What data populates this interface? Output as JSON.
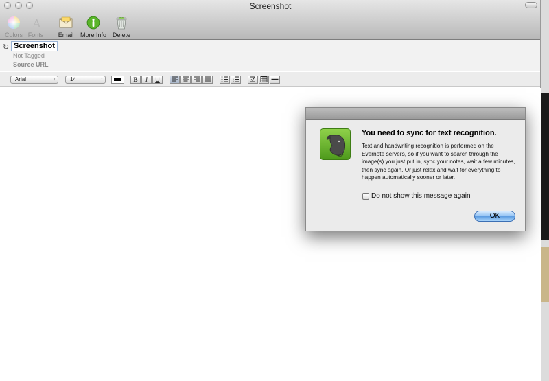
{
  "window": {
    "title": "Screenshot"
  },
  "toolbar": {
    "items": [
      {
        "label": "Colors",
        "icon": "color-wheel-icon",
        "enabled": false
      },
      {
        "label": "Fonts",
        "icon": "fonts-icon",
        "enabled": false
      },
      {
        "label": "Email",
        "icon": "envelope-icon",
        "enabled": true
      },
      {
        "label": "More Info",
        "icon": "info-icon",
        "enabled": true
      },
      {
        "label": "Delete",
        "icon": "trash-icon",
        "enabled": true
      }
    ]
  },
  "note": {
    "title": "Screenshot",
    "tags": "Not Tagged",
    "source": "Source URL"
  },
  "formatbar": {
    "font": "Arial",
    "size": "14",
    "text_color": "#000000",
    "bold": "B",
    "italic": "I",
    "underline": "U"
  },
  "dialog": {
    "heading": "You need to sync for text recognition.",
    "body": "Text and handwriting recognition is performed on the Evernote servers, so if you want to search through the image(s) you just put in, sync your notes, wait a few minutes, then sync again.  Or just relax and wait for everything to happen automatically sooner or later.",
    "checkbox_label": "Do not show this message again",
    "checkbox_checked": false,
    "ok_label": "OK",
    "icon": "evernote-elephant-icon"
  },
  "colors": {
    "ok_button": "#8fc0f2",
    "evernote_green": "#6cb52d"
  }
}
